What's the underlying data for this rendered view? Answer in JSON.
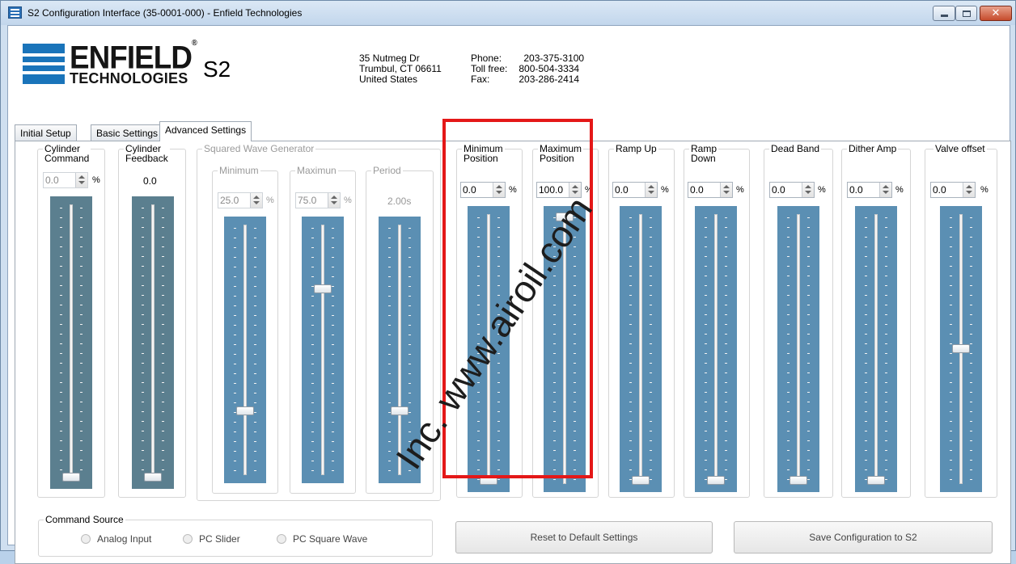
{
  "window": {
    "title": "S2 Configuration Interface (35-0001-000) - Enfield Technologies"
  },
  "header": {
    "logo_line1": "ENFIELD",
    "logo_line2": "TECHNOLOGIES",
    "logo_reg": "®",
    "model": "S2",
    "address": [
      "35 Nutmeg Dr",
      "Trumbul, CT 06611",
      "United States"
    ],
    "contact_labels": [
      "Phone:",
      "Toll free:",
      "Fax:"
    ],
    "contact_values": [
      "203-375-3100",
      "800-504-3334",
      "203-286-2414"
    ]
  },
  "tabs": [
    "Initial Setup",
    "Basic Settings",
    "Advanced Settings"
  ],
  "active_tab": "Advanced Settings",
  "groups": {
    "cyl_cmd": {
      "label_line1": "Cylinder",
      "label_line2": "Command",
      "value": "0.0",
      "unit": "%",
      "level": 0.0
    },
    "cyl_fb": {
      "label_line1": "Cylinder",
      "label_line2": "Feedback",
      "value": "0.0",
      "level": 0.0
    },
    "sq_wave": {
      "label": "Squared Wave Generator",
      "minimum": {
        "label": "Minimum",
        "value": "25.0",
        "unit": "%",
        "level": 0.25
      },
      "maximum": {
        "label": "Maximun",
        "value": "75.0",
        "unit": "%",
        "level": 0.75
      },
      "period": {
        "label": "Period",
        "value": "2.00s",
        "level": 0.25
      }
    },
    "min_pos": {
      "label_line1": "Minimum",
      "label_line2": "Position",
      "value": "0.0",
      "unit": "%",
      "level": 0.0
    },
    "max_pos": {
      "label_line1": "Maximum",
      "label_line2": "Position",
      "value": "100.0",
      "unit": "%",
      "level": 1.0
    },
    "ramp_up": {
      "label": "Ramp Up",
      "value": "0.0",
      "unit": "%",
      "level": 0.0
    },
    "ramp_down": {
      "label_line1": "Ramp",
      "label_line2": "Down",
      "value": "0.0",
      "unit": "%",
      "level": 0.0
    },
    "dead_band": {
      "label": "Dead Band",
      "value": "0.0",
      "unit": "%",
      "level": 0.0
    },
    "dither_amp": {
      "label": "Dither Amp",
      "value": "0.0",
      "unit": "%",
      "level": 0.0
    },
    "valve_offset": {
      "label": "Valve offset",
      "value": "0.0",
      "unit": "%",
      "level": 0.5
    }
  },
  "command_source": {
    "label": "Command Source",
    "options": [
      "Analog Input",
      "PC Slider",
      "PC Square Wave"
    ]
  },
  "buttons": {
    "reset": "Reset to Default Settings",
    "save": "Save Configuration to S2"
  },
  "watermark": "Inc. www.airoil.com",
  "colors": {
    "slider": "#5b8fb3",
    "slider_dark": "#5b7f8f",
    "highlight": "#e41818"
  }
}
